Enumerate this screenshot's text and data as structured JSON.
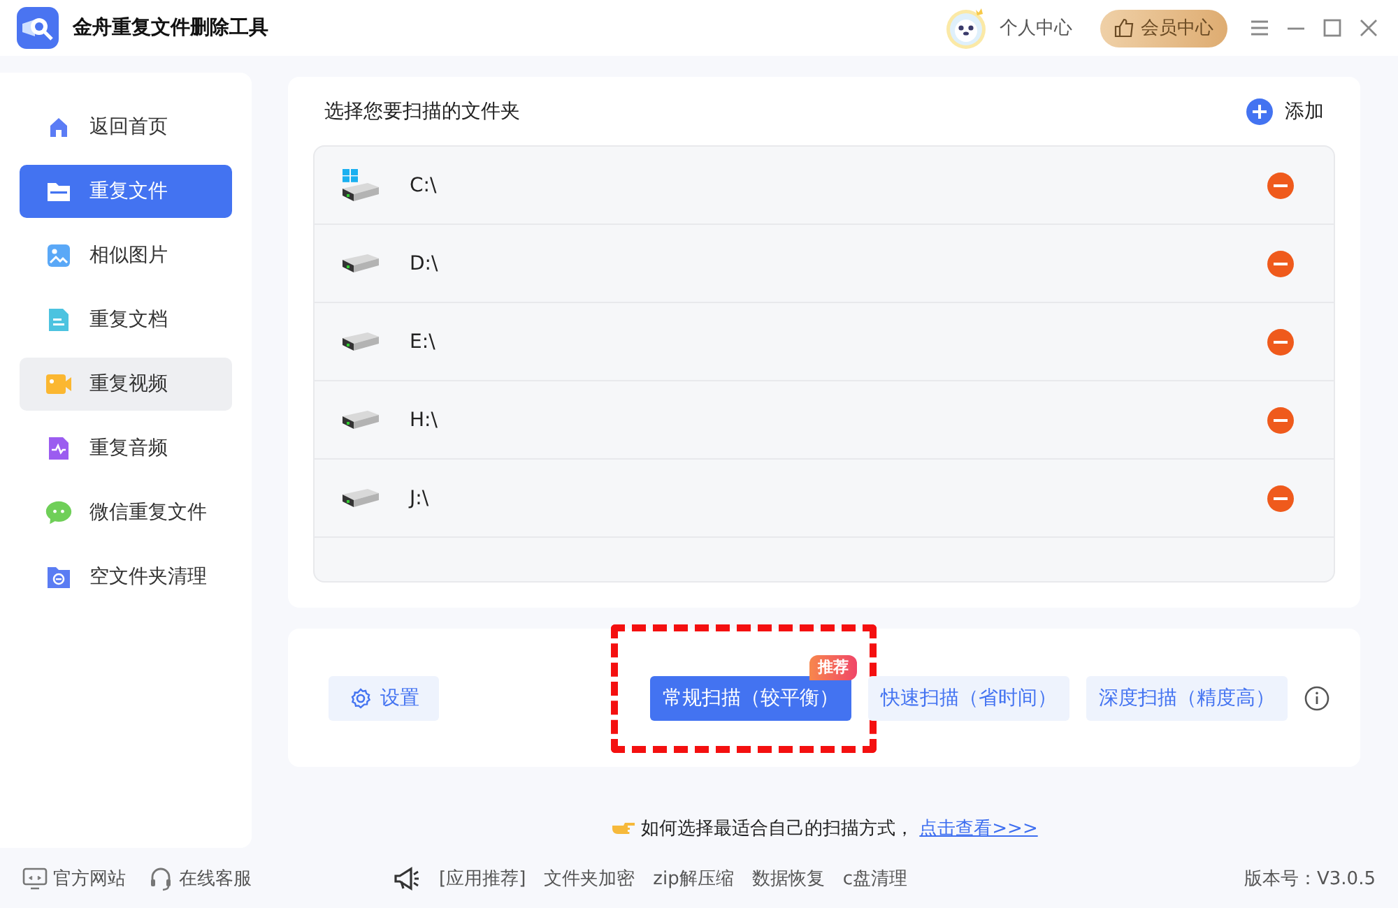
{
  "window": {
    "title": "金舟重复文件删除工具",
    "user_label": "个人中心",
    "vip_label": "会员中心"
  },
  "sidebar": {
    "items": [
      {
        "label": "返回首页",
        "selected": false,
        "hovered": false
      },
      {
        "label": "重复文件",
        "selected": true,
        "hovered": false
      },
      {
        "label": "相似图片",
        "selected": false,
        "hovered": false
      },
      {
        "label": "重复文档",
        "selected": false,
        "hovered": false
      },
      {
        "label": "重复视频",
        "selected": false,
        "hovered": true
      },
      {
        "label": "重复音频",
        "selected": false,
        "hovered": false
      },
      {
        "label": "微信重复文件",
        "selected": false,
        "hovered": false
      },
      {
        "label": "空文件夹清理",
        "selected": false,
        "hovered": false
      }
    ]
  },
  "folders": {
    "title": "选择您要扫描的文件夹",
    "add_label": "添加",
    "items": [
      {
        "path": "C:\\",
        "system": true
      },
      {
        "path": "D:\\",
        "system": false
      },
      {
        "path": "E:\\",
        "system": false
      },
      {
        "path": "H:\\",
        "system": false
      },
      {
        "path": "J:\\",
        "system": false
      }
    ]
  },
  "scan": {
    "settings_label": "设置",
    "modes": [
      {
        "label": "常规扫描（较平衡）",
        "selected": true,
        "badge": "推荐",
        "annotated": true
      },
      {
        "label": "快速扫描（省时间）",
        "selected": false,
        "annotated": false
      },
      {
        "label": "深度扫描（精度高）",
        "selected": false,
        "annotated": false
      }
    ]
  },
  "hint": {
    "text": "如何选择最适合自己的扫描方式，",
    "link": "点击查看>>>"
  },
  "footer": {
    "links": [
      {
        "label": "官方网站"
      },
      {
        "label": "在线客服"
      }
    ],
    "recommend_label": "[应用推荐]",
    "apps": [
      "文件夹加密",
      "zip解压缩",
      "数据恢复",
      "c盘清理"
    ],
    "version": "版本号：V3.0.5"
  }
}
